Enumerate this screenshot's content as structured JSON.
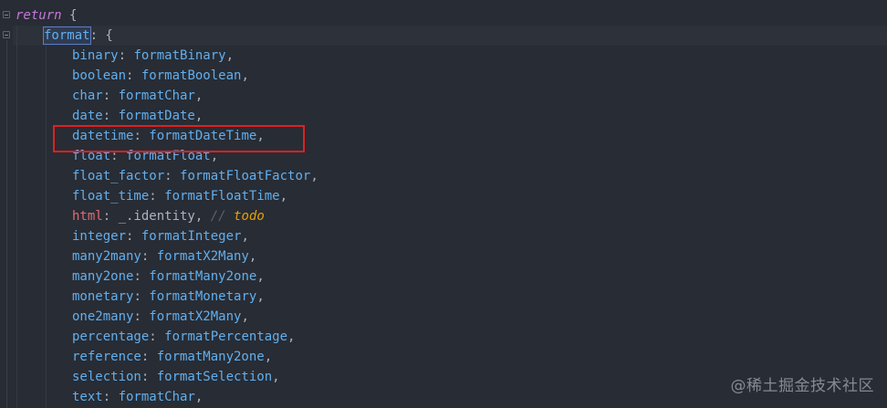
{
  "code": {
    "lines": [
      {
        "kw": "return",
        "rest": " {"
      },
      {
        "format_word": "format",
        "rest": ": {"
      },
      {
        "key": "binary",
        "val": "formatBinary"
      },
      {
        "key": "boolean",
        "val": "formatBoolean"
      },
      {
        "key": "char",
        "val": "formatChar"
      },
      {
        "key": "date",
        "val": "formatDate"
      },
      {
        "key": "datetime",
        "val": "formatDateTime"
      },
      {
        "key": "float",
        "val": "formatFloat"
      },
      {
        "key": "float_factor",
        "val": "formatFloatFactor"
      },
      {
        "key": "float_time",
        "val": "formatFloatTime"
      },
      {
        "key": "html",
        "val": "_.identity",
        "comment": "//",
        "todo": "todo"
      },
      {
        "key": "integer",
        "val": "formatInteger"
      },
      {
        "key": "many2many",
        "val": "formatX2Many"
      },
      {
        "key": "many2one",
        "val": "formatMany2one"
      },
      {
        "key": "monetary",
        "val": "formatMonetary"
      },
      {
        "key": "one2many",
        "val": "formatX2Many"
      },
      {
        "key": "percentage",
        "val": "formatPercentage"
      },
      {
        "key": "reference",
        "val": "formatMany2one"
      },
      {
        "key": "selection",
        "val": "formatSelection"
      },
      {
        "key": "text",
        "val": "formatChar"
      }
    ]
  },
  "watermark": "@稀土掘金技术社区",
  "colors": {
    "background": "#282c34",
    "keyword": "#c678dd",
    "identifier": "#61afef",
    "html_key": "#e06c75",
    "todo": "#e5a000",
    "highlight_box": "#e02020"
  }
}
